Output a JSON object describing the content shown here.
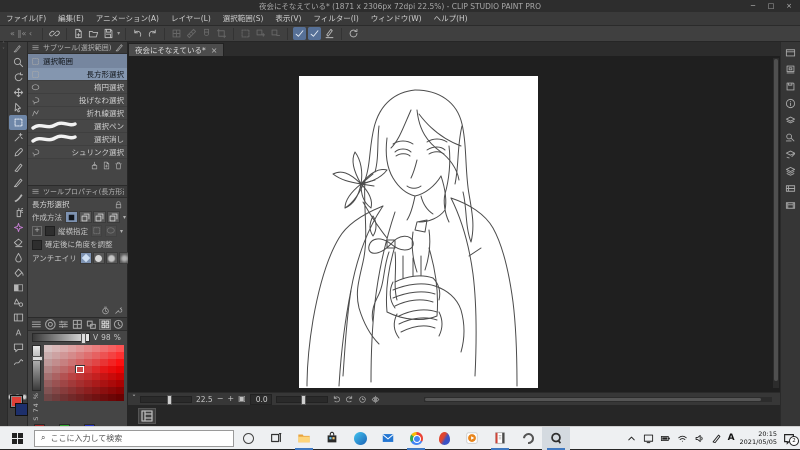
{
  "window": {
    "title": "夜会にそなえている* (1871 x 2306px 72dpi 22.5%) - CLIP STUDIO PAINT PRO",
    "minimize": "─",
    "maximize": "□",
    "close": "×"
  },
  "menubar": {
    "items": [
      "ファイル(F)",
      "編集(E)",
      "アニメーション(A)",
      "レイヤー(L)",
      "選択範囲(S)",
      "表示(V)",
      "フィルター(I)",
      "ウィンドウ(W)",
      "ヘルプ(H)"
    ]
  },
  "toolbar": {
    "collapse_glyphs": "«  ‖«  ‹",
    "groups": [
      {
        "icons": [
          {
            "name": "link",
            "state": "normal"
          }
        ]
      },
      {
        "icons": [
          {
            "name": "new-doc",
            "state": "normal"
          },
          {
            "name": "open-folder",
            "state": "normal"
          },
          {
            "name": "save",
            "state": "normal",
            "dropdown": true
          }
        ]
      },
      {
        "icons": [
          {
            "name": "undo",
            "state": "normal"
          },
          {
            "name": "redo",
            "state": "normal"
          }
        ]
      },
      {
        "icons": [
          {
            "name": "grid",
            "state": "disabled"
          },
          {
            "name": "ruler",
            "state": "disabled"
          },
          {
            "name": "magnet",
            "state": "disabled"
          },
          {
            "name": "crop",
            "state": "disabled"
          }
        ]
      },
      {
        "icons": [
          {
            "name": "select-rect",
            "state": "disabled"
          },
          {
            "name": "select-add",
            "state": "disabled"
          },
          {
            "name": "select-sub",
            "state": "disabled"
          }
        ]
      },
      {
        "icons": [
          {
            "name": "check",
            "state": "active"
          },
          {
            "name": "check",
            "state": "active"
          },
          {
            "name": "pencil-line",
            "state": "normal"
          }
        ]
      },
      {
        "icons": [
          {
            "name": "rotate-view",
            "state": "normal"
          }
        ]
      }
    ]
  },
  "tool_palette": {
    "tools": [
      {
        "name": "zoom"
      },
      {
        "name": "rotate-canvas"
      },
      {
        "name": "move"
      },
      {
        "name": "operation"
      },
      {
        "name": "selection",
        "selected": true
      },
      {
        "name": "auto-select"
      },
      {
        "name": "eyedropper"
      },
      {
        "name": "pen"
      },
      {
        "name": "pencil"
      },
      {
        "name": "brush"
      },
      {
        "name": "airbrush"
      },
      {
        "name": "decoration",
        "accent": "#c77fd4"
      },
      {
        "name": "eraser"
      },
      {
        "name": "blend"
      },
      {
        "name": "fill"
      },
      {
        "name": "gradient"
      },
      {
        "name": "figure"
      },
      {
        "name": "frame"
      },
      {
        "name": "text"
      },
      {
        "name": "balloon"
      },
      {
        "name": "correct-line"
      }
    ],
    "foreground_color": "#e04038",
    "background_color": "#1d2f6b"
  },
  "subtool_panel": {
    "header": "サブツール(選択範囲)",
    "group_label": "選択範囲",
    "items": [
      {
        "label": "長方形選択",
        "icon": "select-rect",
        "selected": true
      },
      {
        "label": "楕円選択",
        "icon": "select-ellipse"
      },
      {
        "label": "投げなわ選択",
        "icon": "lasso"
      },
      {
        "label": "折れ線選択",
        "icon": "polyline"
      },
      {
        "label": "選択ペン",
        "icon": "stroke-thumb"
      },
      {
        "label": "選択消し",
        "icon": "stroke-thumb"
      },
      {
        "label": "シュリンク選択",
        "icon": "lasso"
      }
    ],
    "footer_icons": [
      "import",
      "new-page",
      "trash"
    ]
  },
  "tool_property": {
    "header": "ツールプロパティ(長方形選択)",
    "title": "長方形選択",
    "labels": {
      "create": "作成方法",
      "aspect": "縦横指定",
      "angle": "確定後に角度を調整",
      "antialias": "アンチエイリ"
    },
    "create_buttons": [
      "new-sel",
      "add-sel",
      "sub-sel",
      "multi-sel"
    ],
    "footer_icons": [
      "timer",
      "wrench"
    ]
  },
  "color_panel": {
    "tabs": [
      "color-wheel",
      "color-slider",
      "color-set",
      "mix-color",
      "approx-color",
      "color-history"
    ],
    "active_tab": 4,
    "v_label": "V",
    "v_value": "98",
    "v_unit": "%",
    "s_label": "S",
    "s_value": "74",
    "s_unit": "%",
    "grid": {
      "rows": 8,
      "cols": 10,
      "hue": 0,
      "sel_row": 3,
      "sel_col": 4
    },
    "history_colors": [
      "#a32525",
      "#2da32d",
      "#2433c4"
    ]
  },
  "document": {
    "tab_label": "夜会にそなえている*",
    "tab_close": "×",
    "statusbar_collapse": "ˇ",
    "zoom_value": "22.5",
    "zoom_minus": "−",
    "zoom_plus": "+",
    "rotate_value": "0.0",
    "nav_icons": [
      "rotate-ccw",
      "rotate-cw",
      "reset-view",
      "flip-view"
    ]
  },
  "right_dock": {
    "icons": [
      "quick-access",
      "navigator",
      "material",
      "information",
      "layer-property",
      "layer-search",
      "edit-layer",
      "layers",
      "timeline",
      "item-bank"
    ]
  },
  "taskbar": {
    "search_placeholder": "ここに入力して検索",
    "apps": [
      {
        "name": "cortana"
      },
      {
        "name": "task-view"
      },
      {
        "name": "explorer",
        "active": true
      },
      {
        "name": "store"
      },
      {
        "name": "edge"
      },
      {
        "name": "mail"
      },
      {
        "name": "chrome",
        "active": true
      },
      {
        "name": "paint3d"
      },
      {
        "name": "movies"
      },
      {
        "name": "notebook",
        "active": true
      },
      {
        "name": "clip-studio"
      },
      {
        "name": "clip-studio-paint",
        "active": true,
        "focused": true
      }
    ],
    "tray_icons": [
      "chevron-up",
      "tablet",
      "battery",
      "wifi",
      "volume",
      "pen"
    ],
    "ime": "A",
    "time": "20:15",
    "date": "2021/05/05",
    "notification_count": "2"
  },
  "colors": {
    "selection_highlight": "#8496af",
    "group_header": "#76869f",
    "toolbar_active": "#567097",
    "taskbar_underline": "#3f78c0",
    "foreground_swatch": "#e04038",
    "background_swatch": "#1d2f6b"
  }
}
